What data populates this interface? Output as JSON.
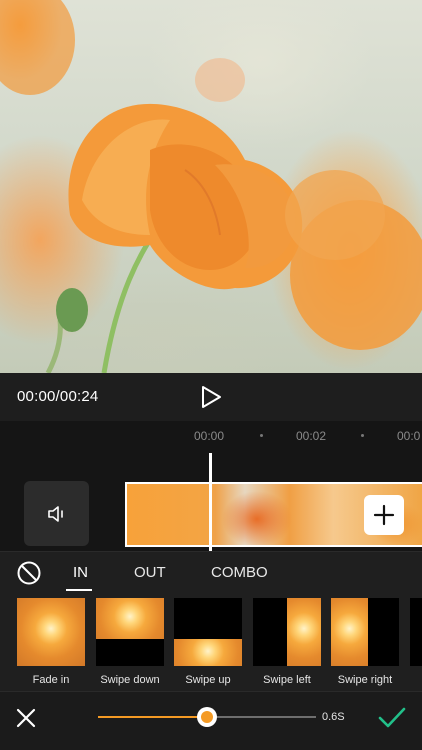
{
  "preview": {
    "image": "orange-poppy-photo"
  },
  "playback": {
    "time": "00:00/00:24",
    "play_icon": "play-icon"
  },
  "timeline": {
    "ticks": [
      "00:00",
      "00:02",
      "00:0"
    ],
    "audio_icon": "speaker-icon",
    "add_icon": "plus-icon"
  },
  "tabs": {
    "none_icon": "no-effect-icon",
    "items": [
      "IN",
      "OUT",
      "COMBO"
    ],
    "active": "IN"
  },
  "effects": [
    {
      "label": "Fade in",
      "kind": "fade-in"
    },
    {
      "label": "Swipe down",
      "kind": "swipe-down"
    },
    {
      "label": "Swipe up",
      "kind": "swipe-up"
    },
    {
      "label": "Swipe left",
      "kind": "swipe-left"
    },
    {
      "label": "Swipe right",
      "kind": "swipe-right"
    }
  ],
  "bottom": {
    "close_icon": "close-icon",
    "duration_fraction": 0.5,
    "duration_label": "0.6S",
    "confirm_icon": "checkmark-icon"
  },
  "colors": {
    "accent": "#f49a24",
    "confirm": "#22c08a"
  }
}
